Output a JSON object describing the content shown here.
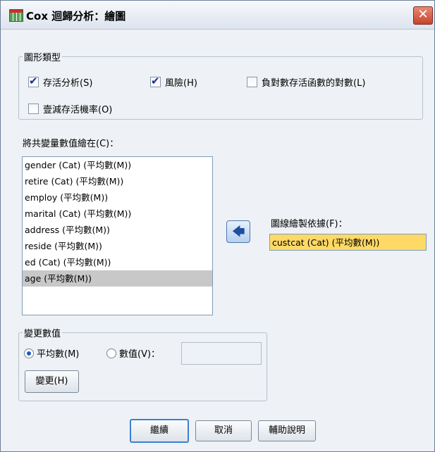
{
  "window": {
    "title": "Cox 迴歸分析：繪圖"
  },
  "plot_type": {
    "legend": "圖形類型",
    "options": [
      {
        "label": "存活分析(S)",
        "checked": true
      },
      {
        "label": "風險(H)",
        "checked": true
      },
      {
        "label": "負對數存活函數的對數(L)",
        "checked": false
      },
      {
        "label": "壹減存活機率(O)",
        "checked": false
      }
    ]
  },
  "covariates": {
    "label": "將共變量數值繪在(C)：",
    "items": [
      "gender (Cat) (平均數(M))",
      "retire (Cat) (平均數(M))",
      "employ (平均數(M))",
      "marital (Cat) (平均數(M))",
      "address (平均數(M))",
      "reside (平均數(M))",
      "ed (Cat) (平均數(M))",
      "age (平均數(M))"
    ],
    "selected_index": 7
  },
  "separate_lines": {
    "label": "圖線繪製依據(F)：",
    "value": "custcat (Cat) (平均數(M))"
  },
  "change_value": {
    "legend": "變更數值",
    "radio_mean": "平均數(M)",
    "radio_value": "數值(V)：",
    "value_input": "",
    "change_button": "變更(H)"
  },
  "buttons": {
    "continue": "繼續",
    "cancel": "取消",
    "help": "輔助說明"
  }
}
